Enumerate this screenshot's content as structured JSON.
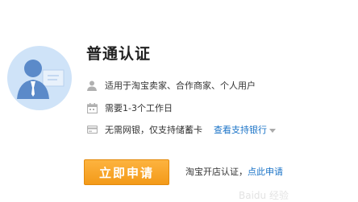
{
  "card": {
    "title": "普通认证",
    "rows": [
      {
        "icon": "person-icon",
        "text": "适用于淘宝卖家、合作商家、个人用户"
      },
      {
        "icon": "calendar-icon",
        "text": "需要1-3个工作日"
      },
      {
        "icon": "bank-card-icon",
        "text": "无需网银，仅支持储蓄卡",
        "link": "查看支持银行"
      }
    ],
    "apply_button": "立即申请",
    "bottom_prefix": "淘宝开店认证，",
    "bottom_link": "点此申请"
  },
  "colors": {
    "accent": "#f39a19",
    "link": "#1a73c7",
    "avatar_bg": "#cfe3f8",
    "avatar_figure": "#5b8ac9"
  }
}
